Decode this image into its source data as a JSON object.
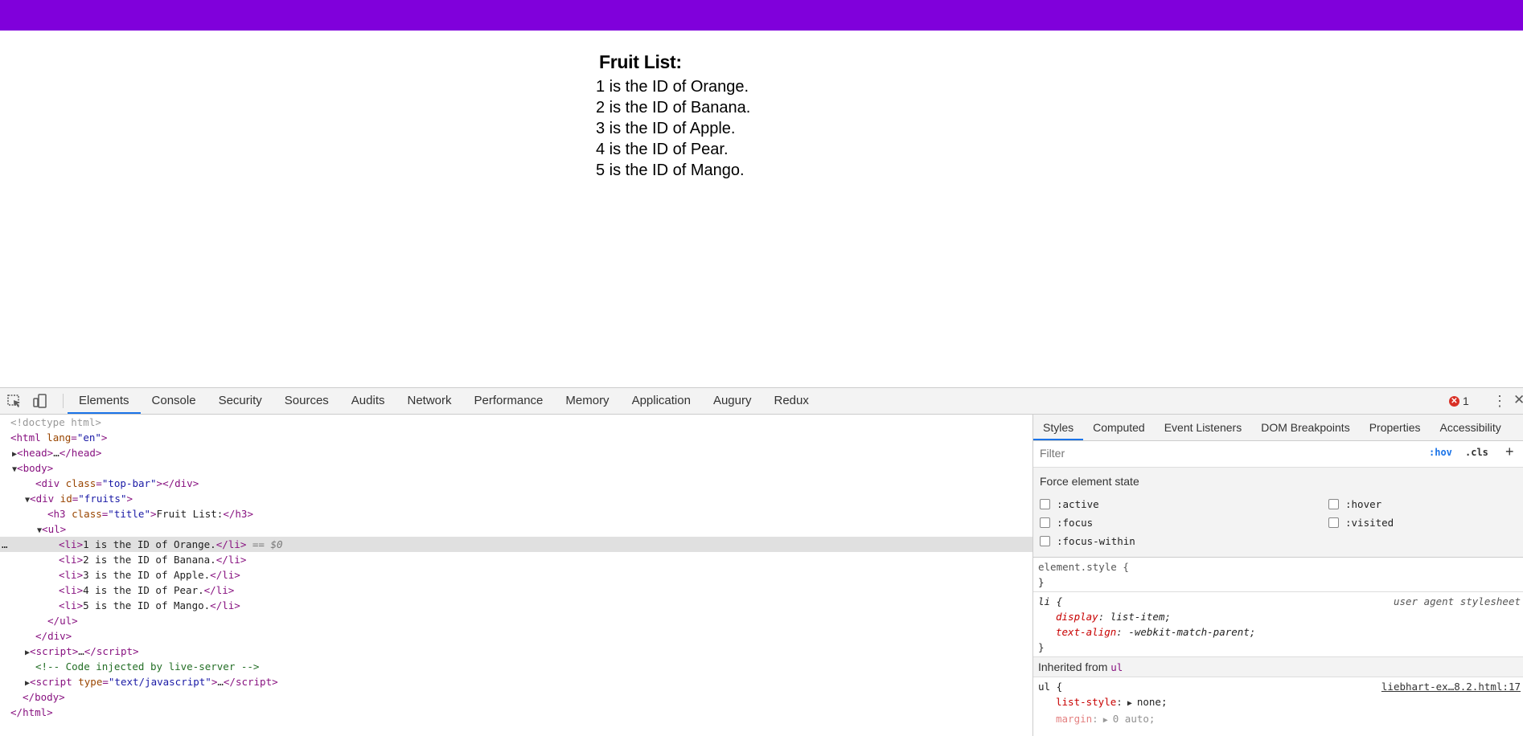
{
  "page": {
    "title": "Fruit List:",
    "fruits": [
      "1 is the ID of Orange.",
      "2 is the ID of Banana.",
      "3 is the ID of Apple.",
      "4 is the ID of Pear.",
      "5 is the ID of Mango."
    ],
    "top_bar_color": "#8000DB"
  },
  "devtools": {
    "tabs": [
      "Elements",
      "Console",
      "Security",
      "Sources",
      "Audits",
      "Network",
      "Performance",
      "Memory",
      "Application",
      "Augury",
      "Redux"
    ],
    "active_tab": "Elements",
    "error_count": "1",
    "icons": [
      "inspect-element-icon",
      "device-toolbar-icon",
      "error-icon",
      "more-options-icon",
      "close-icon"
    ],
    "tree": {
      "doctype": "<!doctype html>",
      "html_open": "html",
      "lang_attr": "lang",
      "lang_val": "\"en\"",
      "head": "head",
      "ellipsis": "…",
      "body": "body",
      "div": "div",
      "class_attr": "class",
      "top_bar_val": "\"top-bar\"",
      "id_attr": "id",
      "fruits_val": "\"fruits\"",
      "h3": "h3",
      "title_val": "\"title\"",
      "h3_text": "Fruit List:",
      "ul": "ul",
      "li": "li",
      "li_items": [
        "1 is the ID of Orange.",
        "2 is the ID of Banana.",
        "3 is the ID of Apple.",
        "4 is the ID of Pear.",
        "5 is the ID of Mango."
      ],
      "selected_marker": "== $0",
      "script": "script",
      "comment": "<!-- Code injected by live-server -->",
      "type_attr": "type",
      "type_val": "\"text/javascript\"",
      "html_close": "html",
      "dots": "…"
    },
    "styles": {
      "tabs": [
        "Styles",
        "Computed",
        "Event Listeners",
        "DOM Breakpoints",
        "Properties",
        "Accessibility"
      ],
      "active_tab": "Styles",
      "filter_placeholder": "Filter",
      "hov": ":hov",
      "cls": ".cls",
      "plus": "+",
      "force_title": "Force element state",
      "states": [
        ":active",
        ":hover",
        ":focus",
        ":visited",
        ":focus-within"
      ],
      "element_style_open": "element.style {",
      "brace_close": "}",
      "li_rule": {
        "selector": "li {",
        "source": "user agent stylesheet",
        "declarations": [
          {
            "prop": "display",
            "value": "list-item;"
          },
          {
            "prop": "text-align",
            "value": "-webkit-match-parent;"
          }
        ]
      },
      "inherited_label": "Inherited from",
      "inherited_tag": "ul",
      "ul_rule": {
        "selector": "ul {",
        "source": "liebhart-ex…8.2.html:17",
        "declarations": [
          {
            "prop": "list-style",
            "value": "none;"
          },
          {
            "prop": "margin",
            "value": "0 auto;"
          }
        ]
      }
    }
  }
}
